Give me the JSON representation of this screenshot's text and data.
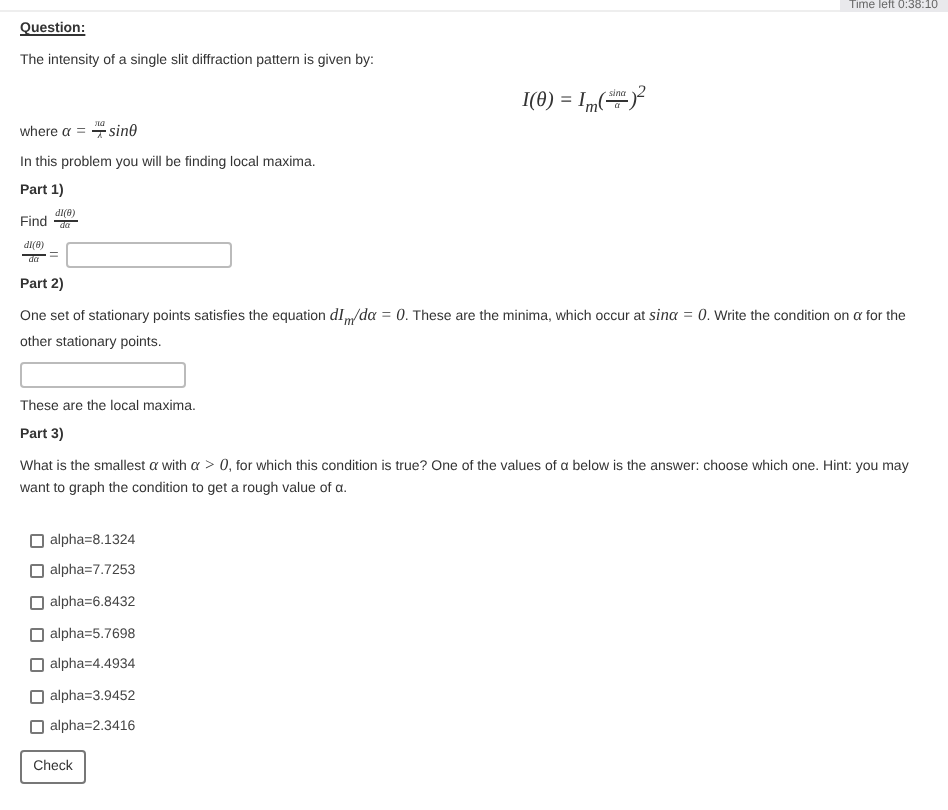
{
  "timer": "Time left 0:38:10",
  "heading": "Question:",
  "blocks": [
    {
      "kind": "paragraph",
      "parts": [
        {
          "kind": "text",
          "text": "The intensity of a single slit diffraction pattern is given by:"
        }
      ]
    },
    {
      "kind": "formula",
      "parts": [
        {
          "kind": "math",
          "text": "I(θ) = I$_{m}$("
        },
        {
          "kind": "frac",
          "num": "sinα",
          "den": "α"
        },
        {
          "kind": "math",
          "text": ")$^{2}$"
        }
      ]
    },
    {
      "kind": "paragraph",
      "parts": [
        {
          "kind": "text",
          "text": "where "
        },
        {
          "kind": "math",
          "text": "α = "
        },
        {
          "kind": "frac",
          "num": "πa",
          "den": "λ"
        },
        {
          "kind": "math",
          "text": "sinθ"
        }
      ]
    },
    {
      "kind": "paragraph",
      "parts": [
        {
          "kind": "text",
          "text": "In this problem you will be finding local maxima."
        }
      ]
    },
    {
      "kind": "part_heading",
      "text": "Part 1)"
    },
    {
      "kind": "paragraph",
      "parts": [
        {
          "kind": "text",
          "text": "Find "
        },
        {
          "kind": "frac",
          "num": "dI(θ)",
          "den": "dα"
        }
      ]
    },
    {
      "kind": "answer",
      "parts": [
        {
          "kind": "frac",
          "num": "dI(θ)",
          "den": "dα"
        },
        {
          "kind": "math",
          "text": " = "
        }
      ]
    },
    {
      "kind": "part_heading",
      "text": "Part 2)"
    },
    {
      "kind": "paragraph",
      "parts": [
        {
          "kind": "text",
          "text": "One set of stationary points satisfies the equation "
        },
        {
          "kind": "math",
          "text": "dI$_{m}$/dα = 0"
        },
        {
          "kind": "text",
          "text": ". These are the minima, which occur at "
        },
        {
          "kind": "math",
          "text": "sinα = 0"
        },
        {
          "kind": "text",
          "text": ". Write the condition on "
        },
        {
          "kind": "math",
          "text": "α"
        },
        {
          "kind": "text",
          "text": " for the other stationary points."
        }
      ]
    },
    {
      "kind": "answer"
    },
    {
      "kind": "paragraph",
      "parts": [
        {
          "kind": "text",
          "text": "These are the local maxima."
        }
      ]
    },
    {
      "kind": "part_heading",
      "text": "Part 3)"
    },
    {
      "kind": "paragraph",
      "parts": [
        {
          "kind": "text",
          "text": "What is the smallest "
        },
        {
          "kind": "math",
          "text": "α"
        },
        {
          "kind": "text",
          "text": " with "
        },
        {
          "kind": "math",
          "text": "α > 0"
        },
        {
          "kind": "text",
          "text": ", for which this condition is true? One of the values of α below is the answer: choose which one. Hint: you may want to graph the condition to get a rough value of α."
        }
      ]
    },
    {
      "kind": "options",
      "items": [
        {
          "label": "alpha=8.1324",
          "checked": false
        },
        {
          "label": "alpha=7.7253",
          "checked": false
        },
        {
          "label": "alpha=6.8432",
          "checked": false
        },
        {
          "label": "alpha=5.7698",
          "checked": false
        },
        {
          "label": "alpha=4.4934",
          "checked": false
        },
        {
          "label": "alpha=3.9452",
          "checked": false
        },
        {
          "label": "alpha=2.3416",
          "checked": false
        }
      ]
    },
    {
      "kind": "button",
      "text": "Check"
    }
  ]
}
